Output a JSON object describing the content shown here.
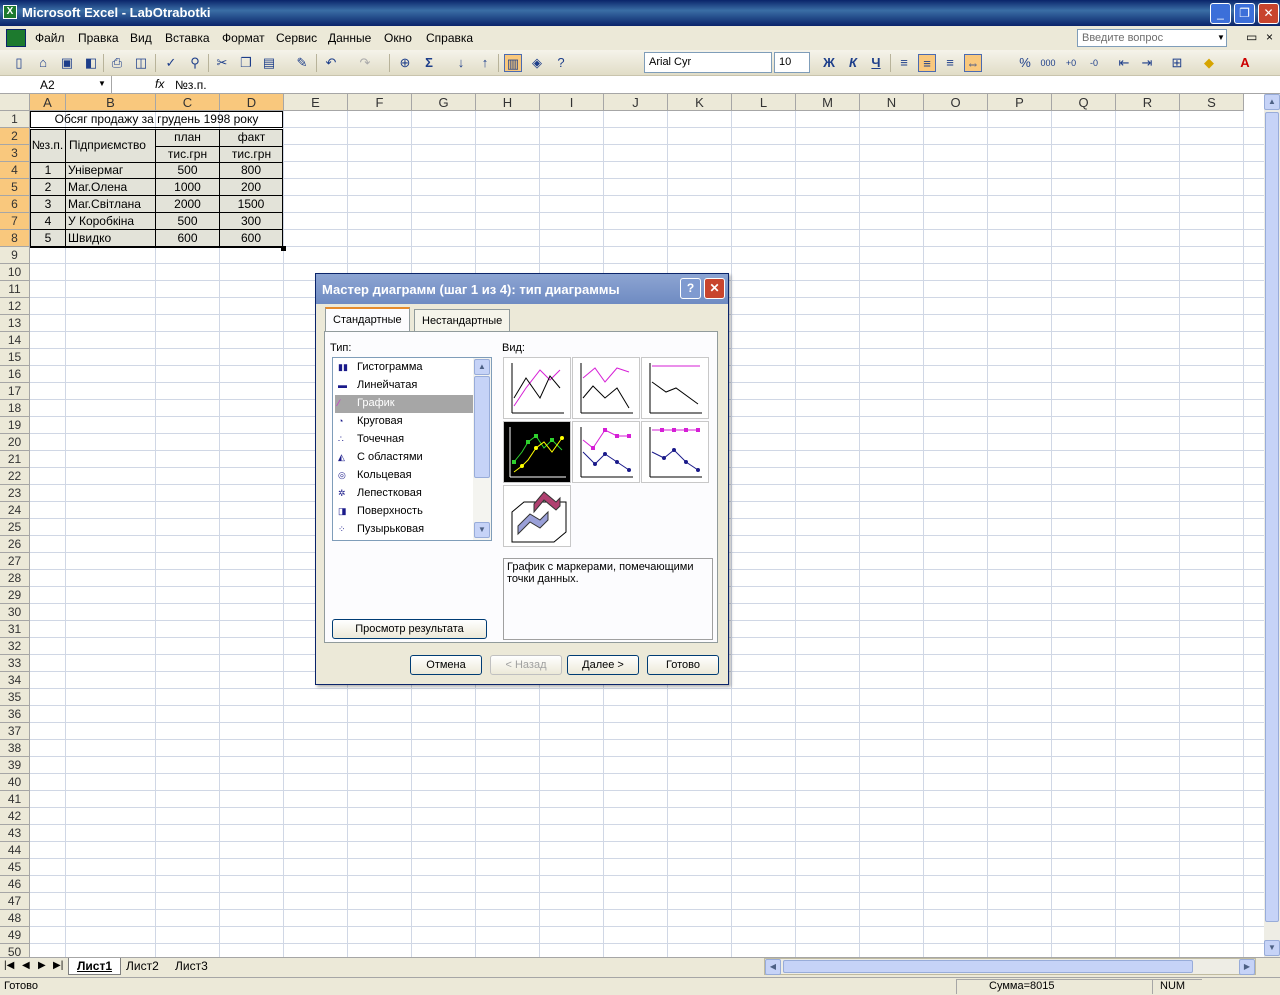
{
  "app": {
    "title": "Microsoft Excel - LabOtrabotki",
    "icon": "excel-icon"
  },
  "menu": [
    "Файл",
    "Правка",
    "Вид",
    "Вставка",
    "Формат",
    "Сервис",
    "Данные",
    "Окно",
    "Справка"
  ],
  "ask_placeholder": "Введите вопрос",
  "font": {
    "name": "Arial Cyr",
    "size": "10",
    "bold": "Ж",
    "italic": "К",
    "underline": "Ч"
  },
  "formula": {
    "cell": "A2",
    "fx": "fx",
    "value": "№з.п."
  },
  "columns": [
    "A",
    "B",
    "C",
    "D",
    "E",
    "F",
    "G",
    "H",
    "I",
    "J",
    "K",
    "L",
    "M",
    "N",
    "O",
    "P",
    "Q",
    "R",
    "S"
  ],
  "rows_count": 50,
  "sheet": {
    "title": "Обсяг продажу за грудень 1998 року",
    "hdr_num": "№з.п.",
    "hdr_ent": "Підприємство",
    "hdr_plan": "план",
    "hdr_fact": "факт",
    "unit": "тис.грн",
    "data": [
      [
        "1",
        "Універмаг",
        "500",
        "800"
      ],
      [
        "2",
        "Маг.Олена",
        "1000",
        "200"
      ],
      [
        "3",
        "Маг.Світлана",
        "2000",
        "1500"
      ],
      [
        "4",
        "У Коробкіна",
        "500",
        "300"
      ],
      [
        "5",
        "Швидко",
        "600",
        "600"
      ]
    ]
  },
  "tabs": [
    "Лист1",
    "Лист2",
    "Лист3"
  ],
  "status": {
    "ready": "Готово",
    "sum": "Сумма=8015",
    "num": "NUM"
  },
  "dialog": {
    "title": "Мастер диаграмм (шаг 1 из 4): тип диаграммы",
    "tab_std": "Стандартные",
    "tab_nonstd": "Нестандартные",
    "type_label": "Тип:",
    "view_label": "Вид:",
    "types": [
      "Гистограмма",
      "Линейчатая",
      "График",
      "Круговая",
      "Точечная",
      "С областями",
      "Кольцевая",
      "Лепестковая",
      "Поверхность",
      "Пузырьковая"
    ],
    "selected_type": "График",
    "description": "График с маркерами, помечающими точки данных.",
    "preview_btn": "Просмотр результата",
    "cancel": "Отмена",
    "back": "< Назад",
    "next": "Далее >",
    "finish": "Готово"
  }
}
